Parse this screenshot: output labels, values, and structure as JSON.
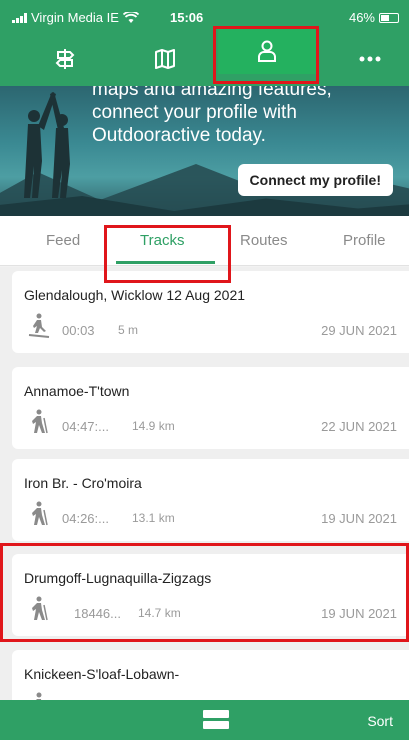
{
  "status": {
    "carrier": "Virgin Media IE",
    "time": "15:06",
    "battery": "46%"
  },
  "nav": {
    "active": "profile"
  },
  "hero": {
    "text_line1": "maps and amazing features,",
    "text_line2": "connect your profile with",
    "text_line3": "Outdooractive today.",
    "connect_label": "Connect my profile!"
  },
  "tabs": [
    {
      "label": "Feed",
      "active": false
    },
    {
      "label": "Tracks",
      "active": true
    },
    {
      "label": "Routes",
      "active": false
    },
    {
      "label": "Profile",
      "active": false
    }
  ],
  "tracks": [
    {
      "title": "Glendalough, Wicklow 12 Aug 2021",
      "duration": "00:03",
      "distance": "5 m",
      "date": "29 JUN 2021",
      "icon": "ski-touring-icon"
    },
    {
      "title": "Annamoe-T'town",
      "duration": "04:47:...",
      "distance": "14.9 km",
      "date": "22 JUN 2021",
      "icon": "hiking-icon"
    },
    {
      "title": "Iron Br. - Cro'moira",
      "duration": "04:26:...",
      "distance": "13.1 km",
      "date": "19 JUN 2021",
      "icon": "hiking-icon"
    },
    {
      "title": "Drumgoff-Lugnaquilla-Zigzags",
      "duration": "18446...",
      "distance": "14.7 km",
      "date": "19 JUN 2021",
      "icon": "hiking-icon"
    },
    {
      "title": "Knickeen-S'loaf-Lobawn-",
      "duration": "",
      "distance": "",
      "date": "",
      "icon": "hiking-icon"
    }
  ],
  "bottom": {
    "sort_label": "Sort"
  },
  "colors": {
    "brand": "#2fa065",
    "highlight": "#e0161b"
  }
}
